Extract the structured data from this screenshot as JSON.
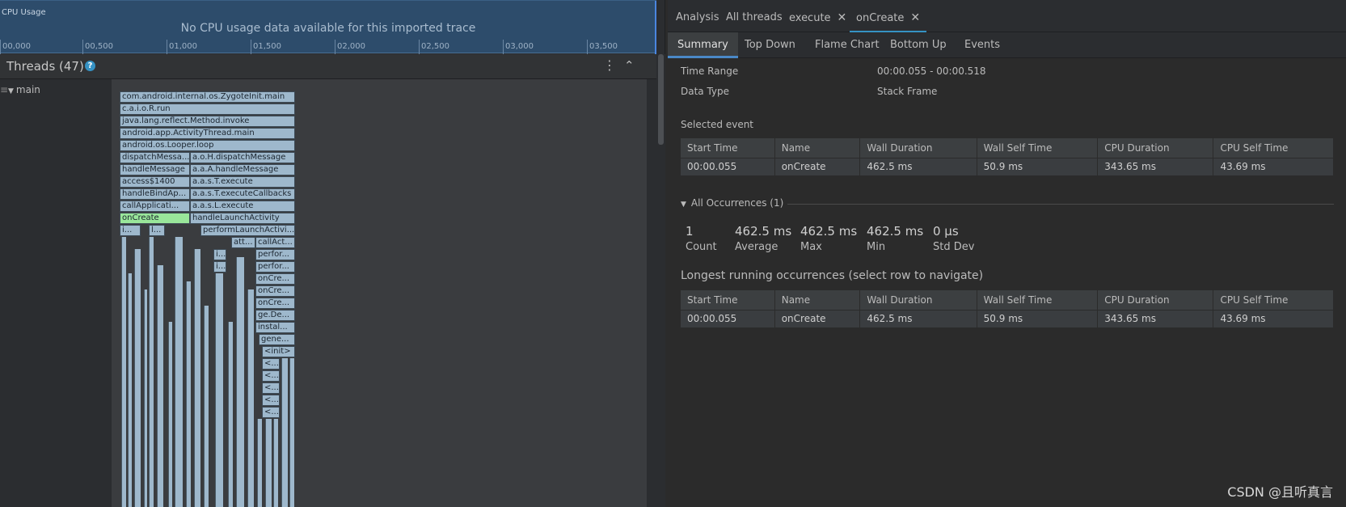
{
  "cpu_usage": {
    "label": "CPU Usage",
    "message": "No CPU usage data available for this imported trace",
    "ticks": [
      "00,000",
      "00,500",
      "01,000",
      "01,500",
      "02,000",
      "02,500",
      "03,000",
      "03,500"
    ]
  },
  "threads": {
    "title": "Threads (47)",
    "help": "?",
    "more": "⋮",
    "collapse": "⌃",
    "main_thread": "main",
    "handle": "≡"
  },
  "flame_frames": [
    "com.android.internal.os.ZygoteInit.main",
    "c.a.i.o.R.run",
    "java.lang.reflect.Method.invoke",
    "android.app.ActivityThread.main",
    "android.os.Looper.loop",
    "dispatchMessa...",
    "a.o.H.dispatchMessage",
    "handleMessage",
    "a.a.A.handleMessage",
    "access$1400",
    "a.a.s.T.execute",
    "handleBindAp...",
    "a.a.s.T.executeCallbacks",
    "callApplicati...",
    "a.a.s.L.execute",
    "onCreate",
    "handleLaunchActivity",
    "i...",
    "l...",
    "performLaunchActivi...",
    "att...",
    "callAct...",
    "i...",
    "perfor...",
    "i...",
    "perfor...",
    "onCre...",
    "onCre...",
    "onCre...",
    "ge.De...",
    "instal...",
    "gene...",
    "<init>",
    "<...",
    "<...",
    "<...",
    "<...",
    "<..."
  ],
  "tabs_top": [
    {
      "label": "Analysis"
    },
    {
      "label": "All threads"
    },
    {
      "label": "execute",
      "close": "✕"
    },
    {
      "label": "onCreate",
      "close": "✕"
    }
  ],
  "tabs_sub": [
    "Summary",
    "Top Down",
    "Flame Chart",
    "Bottom Up",
    "Events"
  ],
  "summary": {
    "time_range_label": "Time Range",
    "time_range_value": "00:00.055 - 00:00.518",
    "data_type_label": "Data Type",
    "data_type_value": "Stack Frame",
    "selected_event_label": "Selected event"
  },
  "table_headers": [
    "Start Time",
    "Name",
    "Wall Duration",
    "Wall Self Time",
    "CPU Duration",
    "CPU Self Time"
  ],
  "selected_event_row": [
    "00:00.055",
    "onCreate",
    "462.5 ms",
    "50.9 ms",
    "343.65 ms",
    "43.69 ms"
  ],
  "all_occurrences": {
    "label": "All Occurrences (1)",
    "stats": [
      {
        "value": "1",
        "label": "Count"
      },
      {
        "value": "462.5 ms",
        "label": "Average"
      },
      {
        "value": "462.5 ms",
        "label": "Max"
      },
      {
        "value": "462.5 ms",
        "label": "Min"
      },
      {
        "value": "0 μs",
        "label": "Std Dev"
      }
    ]
  },
  "longest_label": "Longest running occurrences (select row to navigate)",
  "longest_row": [
    "00:00.055",
    "onCreate",
    "462.5 ms",
    "50.9 ms",
    "343.65 ms",
    "43.69 ms"
  ],
  "watermark": "CSDN @且听真言",
  "colors": {
    "accent": "#3592c4",
    "frame": "#9eb8cc",
    "selected_frame": "#99e69a",
    "cpu_bg": "#2d4c6b"
  }
}
